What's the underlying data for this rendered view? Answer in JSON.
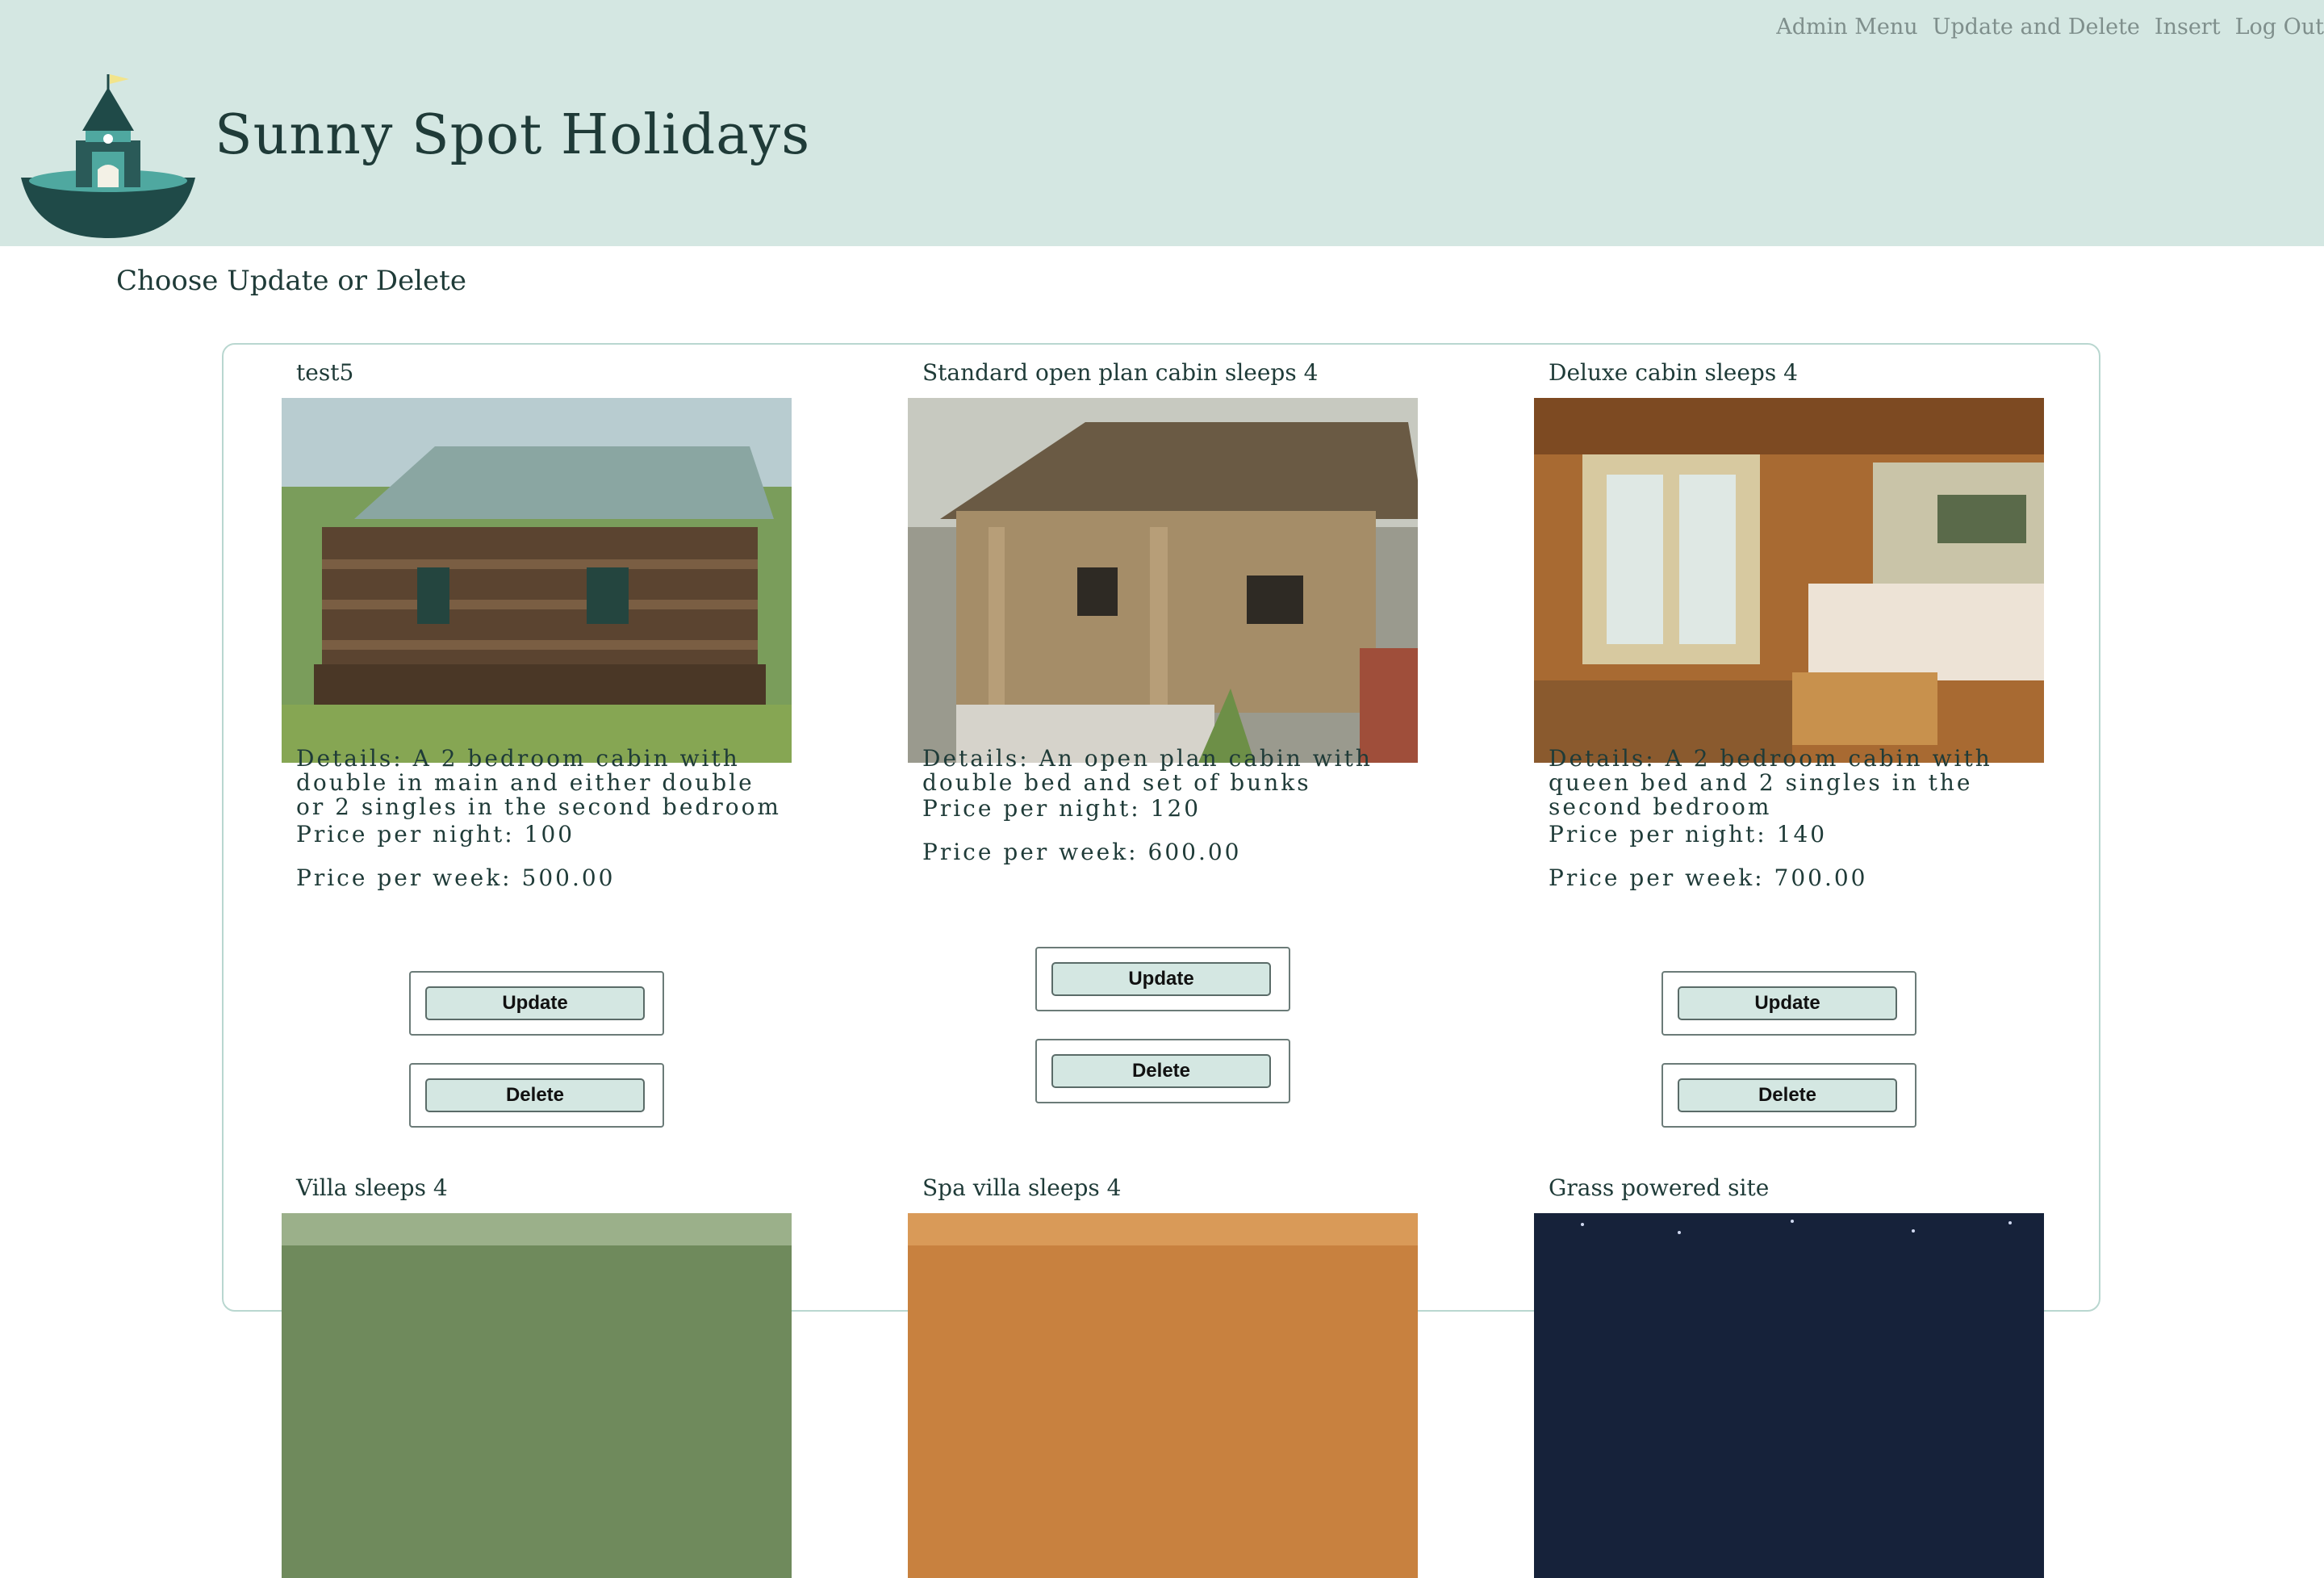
{
  "nav": {
    "items": [
      "Admin Menu",
      "Update and Delete",
      "Insert",
      "Log Out"
    ]
  },
  "site": {
    "title": "Sunny Spot Holidays"
  },
  "page": {
    "heading": "Choose Update or Delete"
  },
  "cabins": [
    {
      "title": "test5",
      "details": "Details: A 2 bedroom cabin with double in main and either double or 2 singles in the second bedroom",
      "price_night": "Price per night: 100",
      "price_week": "Price per week: 500.00",
      "update_label": "Update",
      "delete_label": "Delete"
    },
    {
      "title": "Standard open plan cabin sleeps 4",
      "details": "Details: An open plan cabin with double bed and set of bunks",
      "price_night": "Price per night: 120",
      "price_week": "Price per week: 600.00",
      "update_label": "Update",
      "delete_label": "Delete"
    },
    {
      "title": "Deluxe cabin sleeps 4",
      "details": "Details: A 2 bedroom cabin with queen bed and 2 singles in the second bedroom",
      "price_night": "Price per night: 140",
      "price_week": "Price per week: 700.00",
      "update_label": "Update",
      "delete_label": "Delete"
    },
    {
      "title": "Villa sleeps 4"
    },
    {
      "title": "Spa villa sleeps 4"
    },
    {
      "title": "Grass powered site"
    }
  ],
  "colors": {
    "header_bg": "#d4e7e2",
    "text": "#1f3b38",
    "nav_text": "#7f8f8c",
    "button_bg": "#d4e7e2",
    "panel_border": "#b9d7d0"
  }
}
